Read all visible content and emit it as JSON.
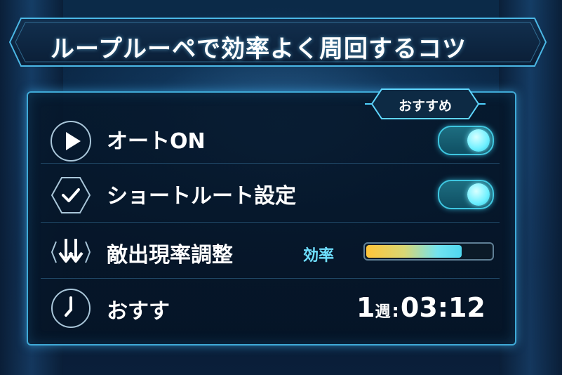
{
  "title": "ループルーペで効率よく周回するコツ",
  "badge": "おすすめ",
  "rows": [
    {
      "label": "オートON",
      "icon": "play-icon",
      "toggle_on": true
    },
    {
      "label": "ショートルート設定",
      "icon": "check-hexagon-icon",
      "toggle_on": true
    },
    {
      "label": "敵出現率調整",
      "icon": "down-arrows-icon",
      "efficiency_label": "効率",
      "efficiency_level": 0.78
    },
    {
      "label": "おすす",
      "icon": "clock-icon",
      "timer": {
        "count": "1",
        "unit": "週",
        "sep": ":",
        "time": "03:12"
      }
    }
  ],
  "colors": {
    "accent": "#3fa9d6",
    "highlight": "#6fe0ff",
    "bar_start": "#ffc53a",
    "bar_end": "#4fd8f0"
  }
}
